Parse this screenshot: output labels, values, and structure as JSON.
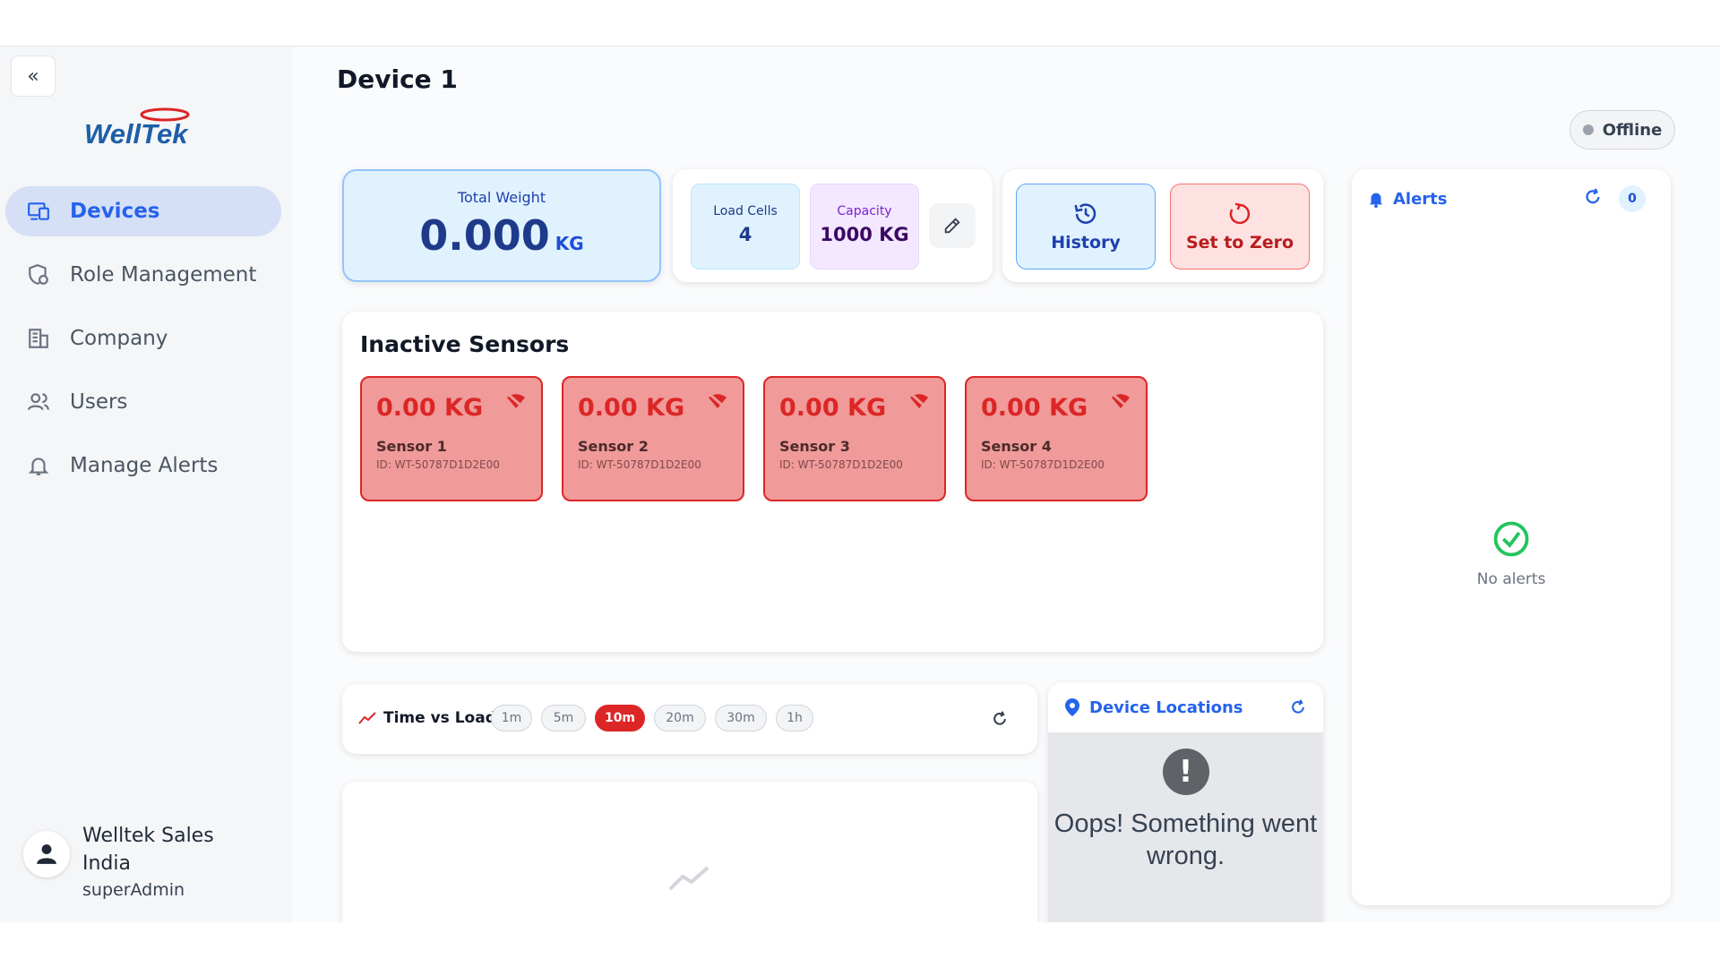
{
  "sidebar": {
    "brand": "WellTek",
    "items": [
      {
        "label": "Devices",
        "icon": "devices-icon",
        "active": true
      },
      {
        "label": "Role Management",
        "icon": "role-shield-icon",
        "active": false
      },
      {
        "label": "Company",
        "icon": "building-icon",
        "active": false
      },
      {
        "label": "Users",
        "icon": "users-icon",
        "active": false
      },
      {
        "label": "Manage Alerts",
        "icon": "bell-icon",
        "active": false
      }
    ],
    "user": {
      "name": "Welltek Sales India",
      "role": "superAdmin"
    }
  },
  "page": {
    "title": "Device 1",
    "status": "Offline"
  },
  "total_weight": {
    "label": "Total Weight",
    "value": "0.000",
    "unit": "KG"
  },
  "specs": {
    "load_cells_label": "Load Cells",
    "load_cells_value": "4",
    "capacity_label": "Capacity",
    "capacity_value": "1000 KG"
  },
  "actions": {
    "history_label": "History",
    "zero_label": "Set to Zero"
  },
  "sensors": {
    "title": "Inactive Sensors",
    "items": [
      {
        "value": "0.00 KG",
        "name": "Sensor 1",
        "id": "ID: WT-50787D1D2E00"
      },
      {
        "value": "0.00 KG",
        "name": "Sensor 2",
        "id": "ID: WT-50787D1D2E00"
      },
      {
        "value": "0.00 KG",
        "name": "Sensor 3",
        "id": "ID: WT-50787D1D2E00"
      },
      {
        "value": "0.00 KG",
        "name": "Sensor 4",
        "id": "ID: WT-50787D1D2E00"
      }
    ]
  },
  "alerts": {
    "title": "Alerts",
    "count": "0",
    "empty_text": "No alerts"
  },
  "time_vs_load": {
    "title": "Time vs Load",
    "ranges": [
      "1m",
      "5m",
      "10m",
      "20m",
      "30m",
      "1h"
    ],
    "selected": "10m"
  },
  "locations": {
    "title": "Device Locations",
    "error_text": "Oops! Something went wrong."
  },
  "colors": {
    "accent": "#2563eb",
    "danger": "#dc2626",
    "success": "#22c55e"
  }
}
